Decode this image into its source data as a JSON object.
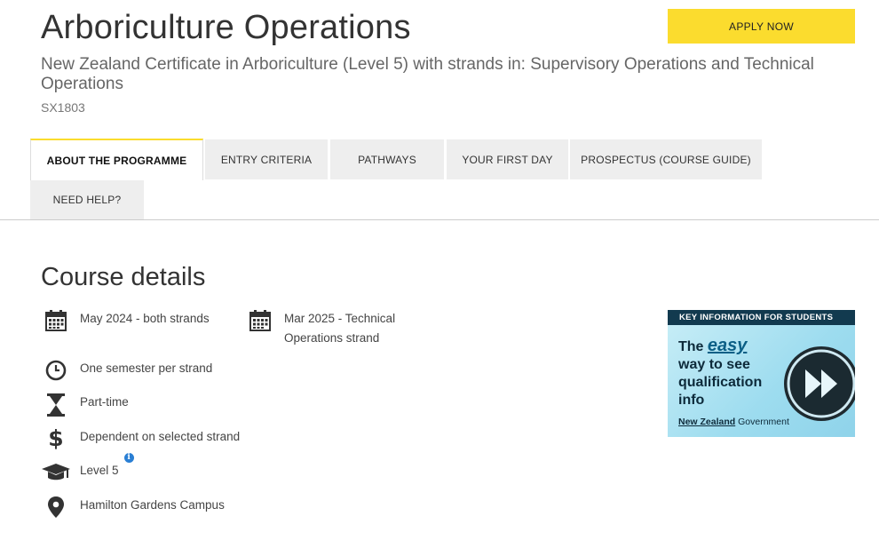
{
  "header": {
    "title": "Arboriculture Operations",
    "subtitle": "New Zealand Certificate in Arboriculture (Level 5) with strands in: Supervisory Operations and Technical Operations",
    "code": "SX1803",
    "apply_label": "APPLY NOW"
  },
  "tabs": [
    {
      "label": "ABOUT THE PROGRAMME",
      "active": true
    },
    {
      "label": "ENTRY CRITERIA"
    },
    {
      "label": "PATHWAYS"
    },
    {
      "label": "YOUR FIRST DAY"
    },
    {
      "label": "PROSPECTUS (COURSE GUIDE)"
    },
    {
      "label": "NEED HELP?"
    }
  ],
  "course": {
    "section_title": "Course details",
    "start_date_1": "May 2024 - both strands",
    "start_date_2_line1": "Mar 2025 - Technical",
    "start_date_2_line2": "Operations strand",
    "duration": "One semester per strand",
    "study_mode": "Part-time",
    "fees": "Dependent on selected strand",
    "level": "Level 5",
    "level_info_icon": "i",
    "campus": "Hamilton Gardens Campus"
  },
  "banner": {
    "heading": "KEY INFORMATION FOR STUDENTS",
    "line1_pre": "The ",
    "line1_em": "easy",
    "line2": "way to see",
    "line3": "qualification",
    "line4": "info",
    "gov_bold": "New Zealand",
    "gov_rest": " Government"
  },
  "colors": {
    "accent": "#fbdc2e",
    "banner_head": "#123a4f",
    "info": "#2a7fd4"
  }
}
